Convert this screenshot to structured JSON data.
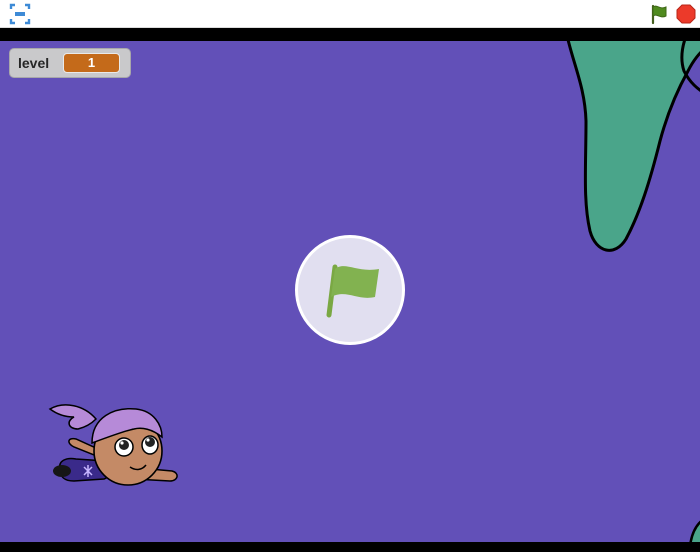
{
  "toolbar": {
    "fullscreen_icon": "fullscreen-icon",
    "flag_icon": "green-flag-icon",
    "stop_icon": "stop-icon"
  },
  "stage": {
    "background_color": "#6250b8",
    "seaweed_color": "#4aa58a"
  },
  "monitor": {
    "label": "level",
    "value": "1"
  },
  "overlay": {
    "icon": "green-flag-icon"
  }
}
